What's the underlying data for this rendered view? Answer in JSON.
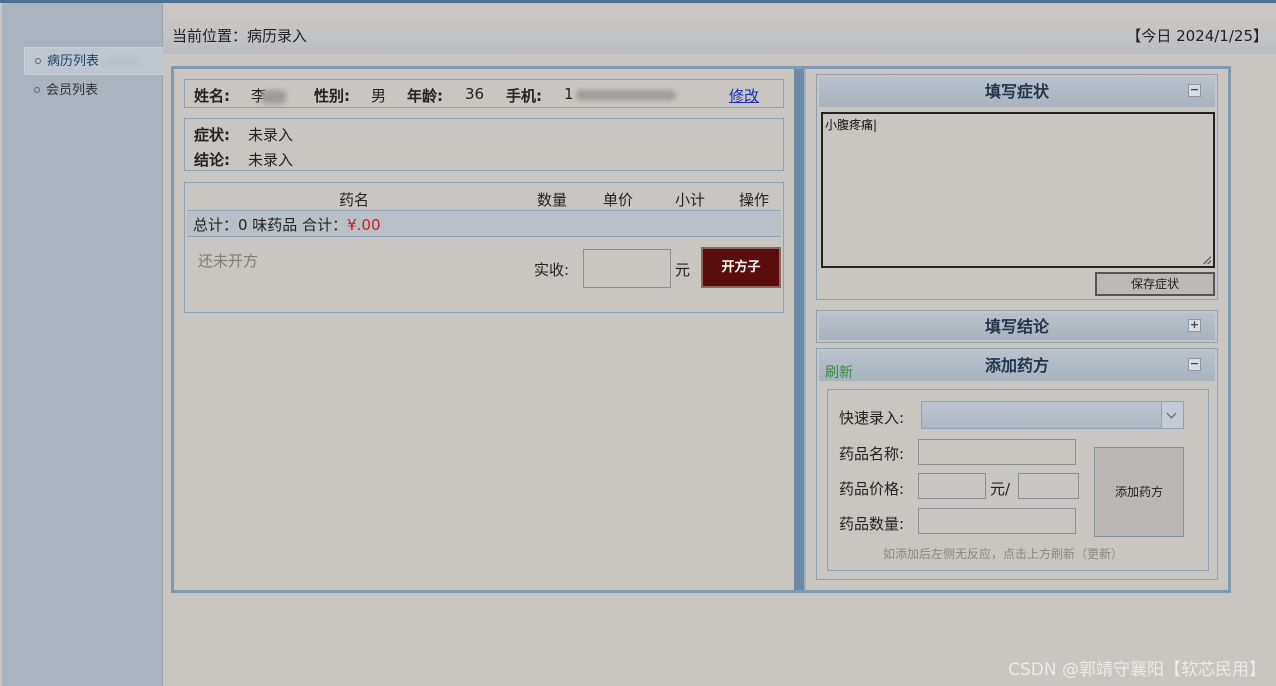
{
  "sidebar": {
    "items": [
      {
        "label": "病历列表",
        "active": true
      },
      {
        "label": "会员列表",
        "active": false
      }
    ]
  },
  "header": {
    "breadcrumb": "当前位置：病历录入",
    "today": "【今日 2024/1/25】"
  },
  "patient": {
    "name_label": "姓名:",
    "name_value": "李",
    "gender_label": "性别:",
    "gender_value": "男",
    "age_label": "年龄:",
    "age_value": "36",
    "phone_label": "手机:",
    "phone_value": "1",
    "edit_link": "修改"
  },
  "diagnosis": {
    "symptom_label": "症状:",
    "symptom_value": "未录入",
    "conclusion_label": "结论:",
    "conclusion_value": "未录入"
  },
  "prescription": {
    "columns": [
      "药名",
      "数量",
      "单价",
      "小计",
      "操作"
    ],
    "total_text": "总计：0 味药品  合计：",
    "total_amount": "¥.00",
    "empty_text": "还未开方",
    "paid_label": "实收:",
    "paid_value": "",
    "currency_unit": "元",
    "submit_button": "开方子"
  },
  "symptom_panel": {
    "title": "填写症状",
    "toggle": "−",
    "text": "小腹疼痛|",
    "save_button": "保存症状"
  },
  "conclusion_panel": {
    "title": "填写结论",
    "toggle": "+"
  },
  "drug_panel": {
    "title": "添加药方",
    "refresh": "刷新",
    "toggle": "−",
    "quick_label": "快速录入:",
    "quick_value": "",
    "name_label": "药品名称:",
    "price_label": "药品价格:",
    "price_unit": "元/",
    "qty_label": "药品数量:",
    "add_button": "添加药方",
    "hint": "如添加后左侧无反应，点击上方刷新（更新）"
  },
  "watermark": "CSDN @郭靖守襄阳【软芯民用】",
  "colors": {
    "accent": "#7f9ab3",
    "submit_button": "#5b0c0c",
    "total_amount": "#c81d1d",
    "refresh": "#2e8b3a",
    "link": "#1a2fb8"
  }
}
